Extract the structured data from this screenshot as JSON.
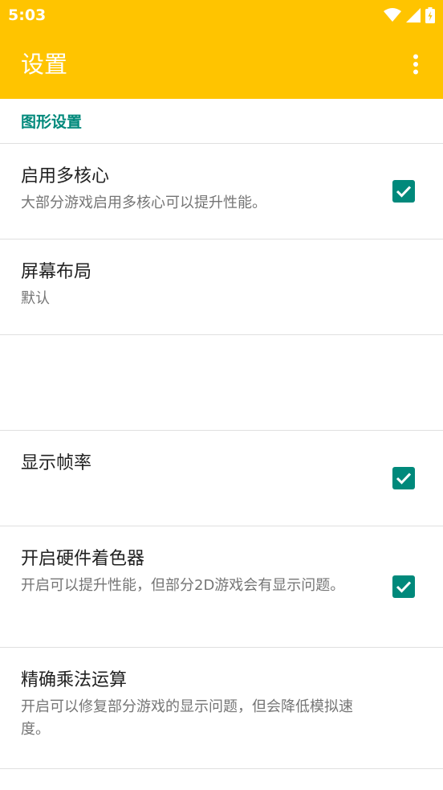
{
  "status_bar": {
    "time": "5:03",
    "icons": [
      "wifi-icon",
      "signal-icon",
      "battery-charging-icon"
    ]
  },
  "toolbar": {
    "title": "设置",
    "menu_icon": "more-vert-icon"
  },
  "colors": {
    "appbar": "#FFC400",
    "accent": "#00897B",
    "title_text": "#212121",
    "summary_text": "#757575",
    "divider": "#E0E0E0"
  },
  "category": {
    "title": "图形设置"
  },
  "preferences": [
    {
      "title": "启用多核心",
      "summary": "大部分游戏启用多核心可以提升性能。",
      "checked": true
    },
    {
      "title": "屏幕布局",
      "summary": "默认"
    },
    {
      "title": "显示帧率",
      "summary": "",
      "checked": true
    },
    {
      "title": "开启硬件着色器",
      "summary": "开启可以提升性能，但部分2D游戏会有显示问题。",
      "checked": true
    },
    {
      "title": "精确乘法运算",
      "summary": "开启可以修复部分游戏的显示问题，但会降低模拟速度。"
    }
  ]
}
